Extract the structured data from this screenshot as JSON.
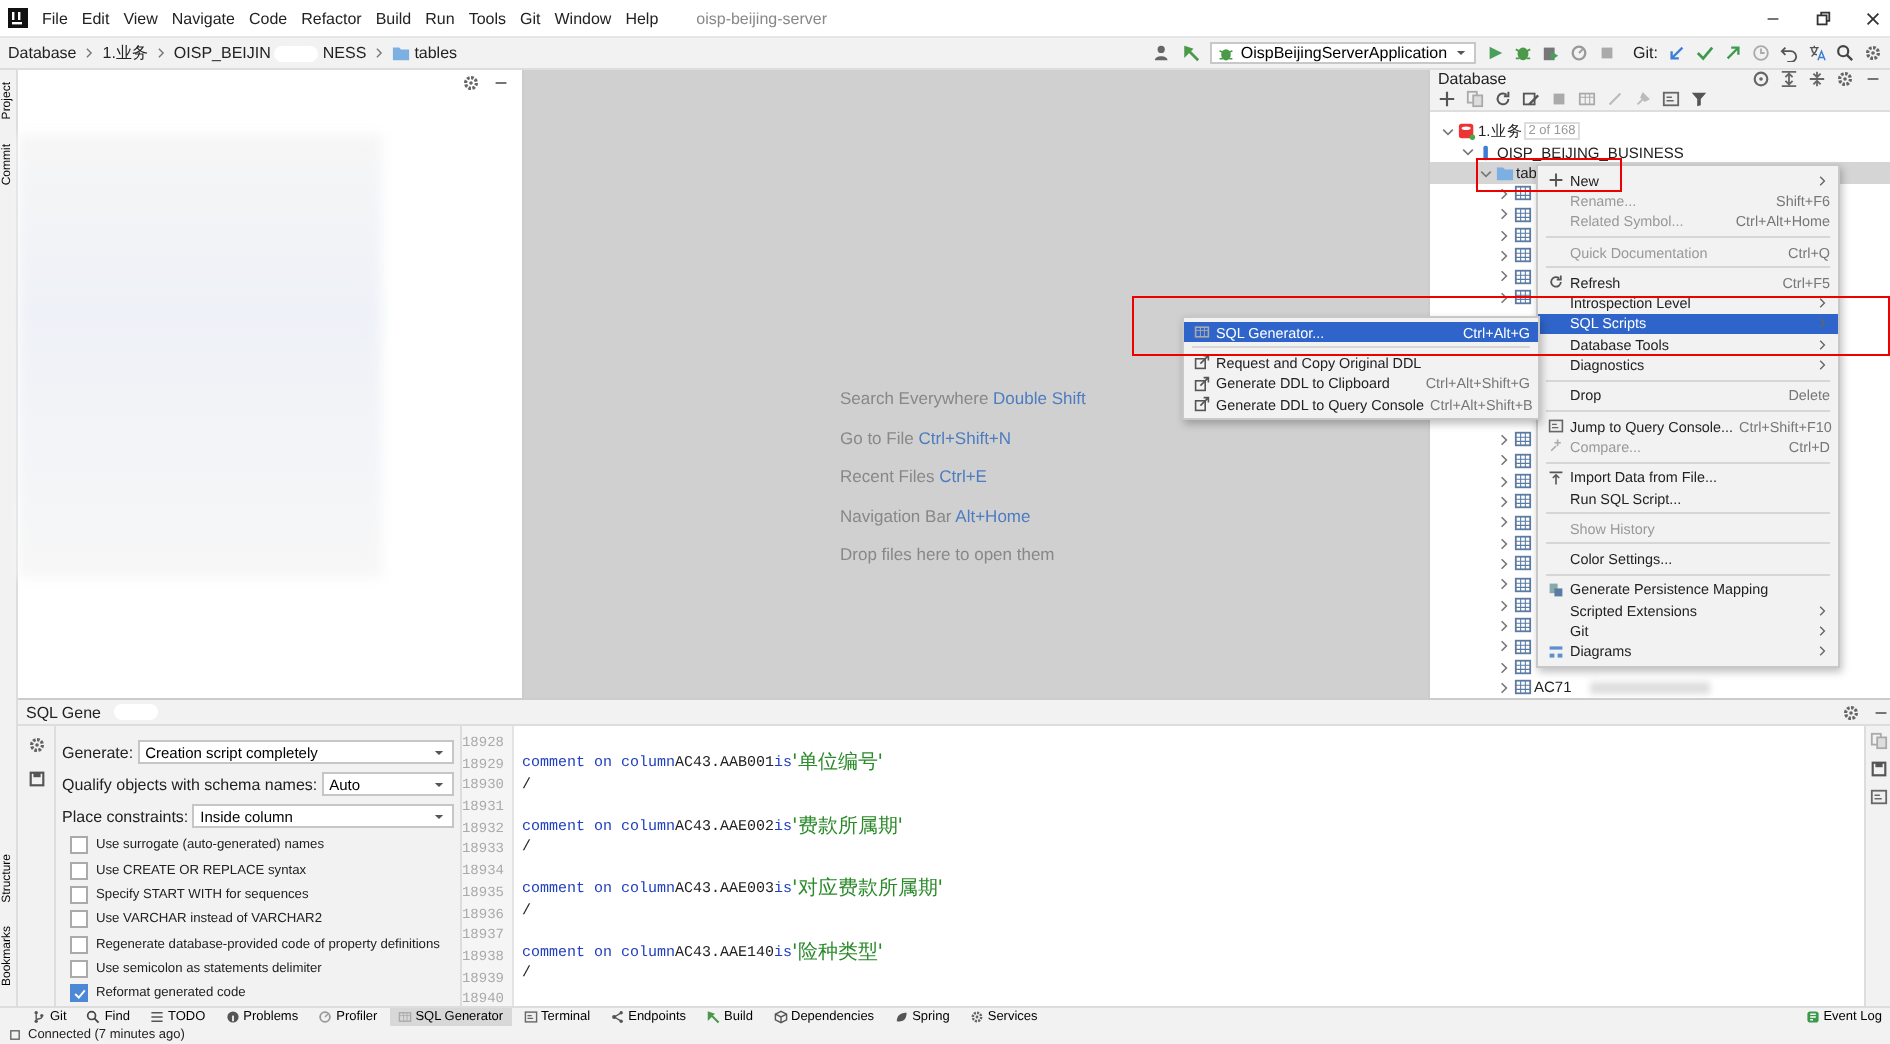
{
  "menu_bar": {
    "items": [
      "File",
      "Edit",
      "View",
      "Navigate",
      "Code",
      "Refactor",
      "Build",
      "Run",
      "Tools",
      "Git",
      "Window",
      "Help"
    ],
    "project_title": "oisp-beijing-server"
  },
  "breadcrumbs": [
    {
      "label": "Database"
    },
    {
      "label": "1.业务"
    },
    {
      "label_start": "OISP_BEIJIN",
      "label_end": "NESS"
    },
    {
      "label": "tables"
    }
  ],
  "run_toolbar": {
    "run_configuration": "OispBeijingServerApplication",
    "git_label": "Git:"
  },
  "side_stripe": {
    "top": [
      "Project",
      "Commit"
    ],
    "bottom": [
      "Structure",
      "Bookmarks"
    ]
  },
  "editor_hints": [
    {
      "label": "Search Everywhere",
      "shortcut": "Double Shift"
    },
    {
      "label": "Go to File",
      "shortcut": "Ctrl+Shift+N"
    },
    {
      "label": "Recent Files",
      "shortcut": "Ctrl+E"
    },
    {
      "label": "Navigation Bar",
      "shortcut": "Alt+Home"
    },
    {
      "label": "Drop files here to open them"
    }
  ],
  "database_panel": {
    "title": "Database",
    "tree": [
      {
        "label": "1.业务",
        "badge": "2 of 168",
        "expanded": true,
        "selected": false
      },
      {
        "label": "OISP_BEIJING_BUSINESS",
        "expanded": true,
        "selected": false
      },
      {
        "label": "tab",
        "expanded": true,
        "selected": true
      }
    ],
    "table_groups": [
      {
        "rows": [
          {
            "expanded": false
          },
          {
            "expanded": false
          },
          {
            "expanded": false
          },
          {
            "expanded": false
          },
          {
            "expanded": false
          },
          {
            "expanded": false
          }
        ]
      },
      {
        "rows": [
          {
            "expanded": false
          },
          {
            "expanded": false
          },
          {
            "expanded": false
          },
          {
            "expanded": false
          },
          {
            "expanded": false
          },
          {
            "expanded": false
          },
          {
            "expanded": false
          },
          {
            "expanded": false
          },
          {
            "expanded": false
          },
          {
            "expanded": false
          },
          {
            "expanded": false
          },
          {
            "expanded": false
          },
          {
            "name": "AC71",
            "expanded": false
          }
        ]
      }
    ]
  },
  "context_menu": [
    {
      "kind": "item",
      "label": "New",
      "submenu": true,
      "disabled": false,
      "selected": false
    },
    {
      "kind": "item",
      "label": "Rename...",
      "shortcut": "Shift+F6",
      "submenu": false,
      "disabled": true,
      "selected": false
    },
    {
      "kind": "item",
      "label": "Related Symbol...",
      "shortcut": "Ctrl+Alt+Home",
      "submenu": false,
      "disabled": true,
      "selected": false
    },
    {
      "kind": "separator"
    },
    {
      "kind": "item",
      "label": "Quick Documentation",
      "shortcut": "Ctrl+Q",
      "submenu": false,
      "disabled": true,
      "selected": false
    },
    {
      "kind": "separator"
    },
    {
      "kind": "item",
      "label": "Refresh",
      "shortcut": "Ctrl+F5",
      "submenu": false,
      "disabled": false,
      "selected": false
    },
    {
      "kind": "item",
      "label": "Introspection Level",
      "submenu": true,
      "disabled": false,
      "selected": false
    },
    {
      "kind": "item",
      "label": "SQL Scripts",
      "submenu": true,
      "disabled": false,
      "selected": true
    },
    {
      "kind": "item",
      "label": "Database Tools",
      "submenu": true,
      "disabled": false,
      "selected": false
    },
    {
      "kind": "item",
      "label": "Diagnostics",
      "submenu": true,
      "disabled": false,
      "selected": false
    },
    {
      "kind": "separator"
    },
    {
      "kind": "item",
      "label": "Drop",
      "shortcut": "Delete",
      "submenu": false,
      "disabled": false,
      "selected": false
    },
    {
      "kind": "separator"
    },
    {
      "kind": "item",
      "label": "Jump to Query Console...",
      "shortcut": "Ctrl+Shift+F10",
      "submenu": false,
      "disabled": false,
      "selected": false
    },
    {
      "kind": "item",
      "label": "Compare...",
      "shortcut": "Ctrl+D",
      "submenu": false,
      "disabled": true,
      "selected": false
    },
    {
      "kind": "separator"
    },
    {
      "kind": "item",
      "label": "Import Data from File...",
      "submenu": false,
      "disabled": false,
      "selected": false
    },
    {
      "kind": "item",
      "label": "Run SQL Script...",
      "submenu": false,
      "disabled": false,
      "selected": false
    },
    {
      "kind": "separator"
    },
    {
      "kind": "item",
      "label": "Show History",
      "submenu": false,
      "disabled": true,
      "selected": false
    },
    {
      "kind": "separator"
    },
    {
      "kind": "item",
      "label": "Color Settings...",
      "submenu": false,
      "disabled": false,
      "selected": false
    },
    {
      "kind": "separator"
    },
    {
      "kind": "item",
      "label": "Generate Persistence Mapping",
      "submenu": false,
      "disabled": false,
      "selected": false
    },
    {
      "kind": "item",
      "label": "Scripted Extensions",
      "submenu": true,
      "disabled": false,
      "selected": false
    },
    {
      "kind": "item",
      "label": "Git",
      "submenu": true,
      "disabled": false,
      "selected": false
    },
    {
      "kind": "item",
      "label": "Diagrams",
      "submenu": true,
      "disabled": false,
      "selected": false
    }
  ],
  "submenu": [
    {
      "kind": "item",
      "label": "SQL Generator...",
      "shortcut": "Ctrl+Alt+G",
      "selected": true
    },
    {
      "kind": "separator"
    },
    {
      "kind": "item",
      "label": "Request and Copy Original DDL",
      "selected": false
    },
    {
      "kind": "item",
      "label": "Generate DDL to Clipboard",
      "shortcut": "Ctrl+Alt+Shift+G",
      "selected": false
    },
    {
      "kind": "item",
      "label": "Generate DDL to Query Console",
      "shortcut": "Ctrl+Alt+Shift+B",
      "selected": false
    }
  ],
  "annotations": [
    {
      "kind": "rectangle"
    },
    {
      "kind": "rectangle"
    }
  ],
  "sql_generator": {
    "title": "SQL Gene",
    "dropdowns": [
      {
        "label": "Generate:",
        "value": "Creation script completely"
      },
      {
        "label": "Qualify objects with schema names:",
        "value": "Auto"
      },
      {
        "label": "Place constraints:",
        "value": "Inside column"
      }
    ],
    "options": [
      {
        "label": "Use surrogate (auto-generated) names",
        "checked": false
      },
      {
        "label": "Use CREATE OR REPLACE syntax",
        "checked": false
      },
      {
        "label": "Specify START WITH for sequences",
        "checked": false
      },
      {
        "label": "Use VARCHAR instead of VARCHAR2",
        "checked": false
      },
      {
        "label": "Regenerate database-provided code of property definitions",
        "checked": false
      },
      {
        "label": "Use semicolon as statements delimiter",
        "checked": false
      },
      {
        "label": "Reformat generated code",
        "checked": true
      }
    ],
    "code_lines": [
      {
        "number": "18928"
      },
      {
        "number": "18929",
        "tokens": [
          {
            "kind": "keyword",
            "text": "comment on column"
          },
          {
            "kind": "ident",
            "text": "AC43.AAB001"
          },
          {
            "kind": "keyword",
            "text": "is"
          },
          {
            "kind": "string",
            "text": "'单位编号'"
          }
        ]
      },
      {
        "number": "18930",
        "tokens": [
          {
            "kind": "ident",
            "text": "/"
          }
        ]
      },
      {
        "number": "18931"
      },
      {
        "number": "18932",
        "tokens": [
          {
            "kind": "keyword",
            "text": "comment on column"
          },
          {
            "kind": "ident",
            "text": "AC43.AAE002"
          },
          {
            "kind": "keyword",
            "text": "is"
          },
          {
            "kind": "string",
            "text": "'费款所属期'"
          }
        ]
      },
      {
        "number": "18933",
        "tokens": [
          {
            "kind": "ident",
            "text": "/"
          }
        ]
      },
      {
        "number": "18934"
      },
      {
        "number": "18935",
        "tokens": [
          {
            "kind": "keyword",
            "text": "comment on column"
          },
          {
            "kind": "ident",
            "text": "AC43.AAE003"
          },
          {
            "kind": "keyword",
            "text": "is"
          },
          {
            "kind": "string",
            "text": "'对应费款所属期'"
          }
        ]
      },
      {
        "number": "18936",
        "tokens": [
          {
            "kind": "ident",
            "text": "/"
          }
        ]
      },
      {
        "number": "18937"
      },
      {
        "number": "18938",
        "tokens": [
          {
            "kind": "keyword",
            "text": "comment on column"
          },
          {
            "kind": "ident",
            "text": "AC43.AAE140"
          },
          {
            "kind": "keyword",
            "text": "is"
          },
          {
            "kind": "string",
            "text": "'险种类型'"
          }
        ]
      },
      {
        "number": "18939",
        "tokens": [
          {
            "kind": "ident",
            "text": "/"
          }
        ]
      },
      {
        "number": "18940"
      }
    ]
  },
  "tool_windows": [
    {
      "label": "Git",
      "selected": false
    },
    {
      "label": "Find",
      "selected": false
    },
    {
      "label": "TODO",
      "selected": false
    },
    {
      "label": "Problems",
      "selected": false
    },
    {
      "label": "Profiler",
      "selected": false
    },
    {
      "label": "SQL Generator",
      "selected": true
    },
    {
      "label": "Terminal",
      "selected": false
    },
    {
      "label": "Endpoints",
      "selected": false
    },
    {
      "label": "Build",
      "selected": false
    },
    {
      "label": "Dependencies",
      "selected": false
    },
    {
      "label": "Spring",
      "selected": false
    },
    {
      "label": "Services",
      "selected": false
    }
  ],
  "event_log": "Event Log",
  "status_bar": "Connected (7 minutes ago)"
}
